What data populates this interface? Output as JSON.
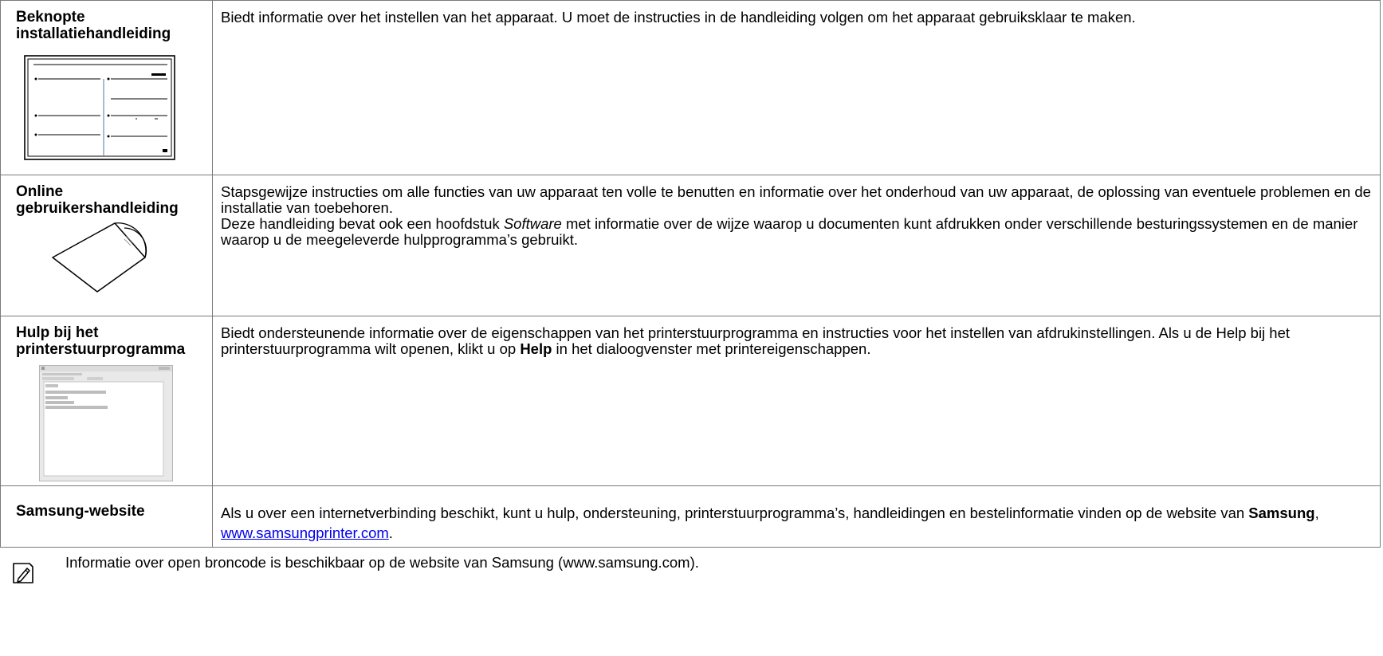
{
  "rows": [
    {
      "label": "Beknopte installatiehandleiding",
      "description": "Biedt informatie over het instellen van het apparaat. U moet de instructies in de handleiding volgen om het apparaat gebruiksklaar te maken."
    },
    {
      "label": "Online gebruikershandleiding",
      "description_p1": "Stapsgewijze instructies om alle functies van uw apparaat ten volle te benutten en informatie over het onderhoud van uw apparaat, de oplossing van eventuele problemen en de installatie van toebehoren.",
      "description_p2_pre": "Deze handleiding bevat ook een hoofdstuk ",
      "description_p2_em": "Software",
      "description_p2_post": " met informatie over de wijze waarop u documenten kunt afdrukken onder verschillende besturingssystemen en de manier waarop u de meegeleverde hulpprogramma’s gebruikt."
    },
    {
      "label": "Hulp bij het printerstuurprogramma",
      "description_pre": "Biedt ondersteunende informatie over de eigenschappen van het printerstuurprogramma en instructies voor het instellen van afdrukinstellingen. Als u de Help bij het printerstuurprogramma wilt openen, klikt u op ",
      "description_bold": "Help",
      "description_post": " in het dialoogvenster met printereigenschappen."
    },
    {
      "label": "Samsung-website",
      "description_pre": "Als u over een internetverbinding beschikt, kunt u hulp, ondersteuning, printerstuurprogramma’s, handleidingen en bestelinformatie vinden op de website van ",
      "description_bold": "Samsung",
      "description_sep": ", ",
      "link_text": "www.samsungprinter.com",
      "description_end": "."
    }
  ],
  "note": {
    "icon": "note-pencil-icon",
    "text": "Informatie over open broncode is beschikbaar op de website van Samsung (www.samsung.com)."
  }
}
